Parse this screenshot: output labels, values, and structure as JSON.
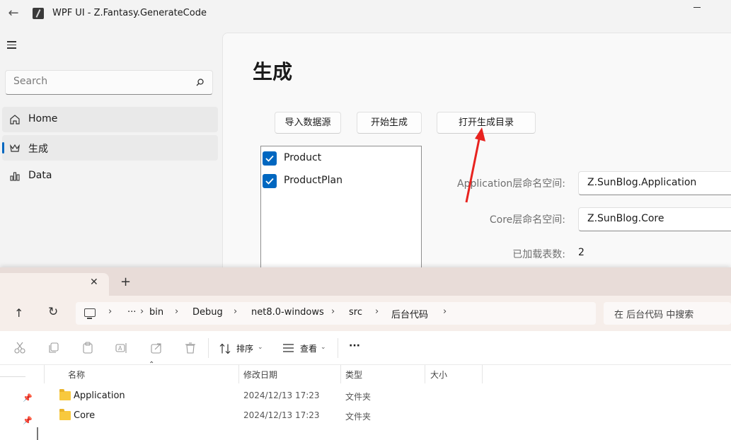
{
  "app": {
    "title": "WPF UI - Z.Fantasy.GenerateCode",
    "search_placeholder": "Search",
    "nav": [
      {
        "label": "Home",
        "icon": "home-icon"
      },
      {
        "label": "生成",
        "icon": "crown-icon"
      },
      {
        "label": "Data",
        "icon": "data-icon"
      }
    ],
    "page_title": "生成",
    "buttons": {
      "import": "导入数据源",
      "generate": "开始生成",
      "open_dir": "打开生成目录"
    },
    "tables": [
      {
        "label": "Product",
        "checked": true
      },
      {
        "label": "ProductPlan",
        "checked": true
      }
    ],
    "form": {
      "app_ns_label": "Application层命名空间:",
      "app_ns_value": "Z.SunBlog.Application",
      "core_ns_label": "Core层命名空间:",
      "core_ns_value": "Z.SunBlog.Core",
      "loaded_label": "已加载表数:",
      "loaded_value": "2"
    },
    "accent_color": "#0067c0",
    "annotation_arrow_color": "#e8231f"
  },
  "explorer": {
    "tab_close": "✕",
    "tab_new": "+",
    "path": [
      "···",
      "bin",
      "Debug",
      "net8.0-windows",
      "src",
      "后台代码"
    ],
    "search_placeholder": "在 后台代码 中搜索",
    "toolbar": {
      "sort_label": "排序",
      "view_label": "查看",
      "more": "···"
    },
    "columns": [
      "名称",
      "修改日期",
      "类型",
      "大小"
    ],
    "rows": [
      {
        "name": "Application",
        "date": "2024/12/13 17:23",
        "type": "文件夹"
      },
      {
        "name": "Core",
        "date": "2024/12/13 17:23",
        "type": "文件夹"
      }
    ]
  }
}
